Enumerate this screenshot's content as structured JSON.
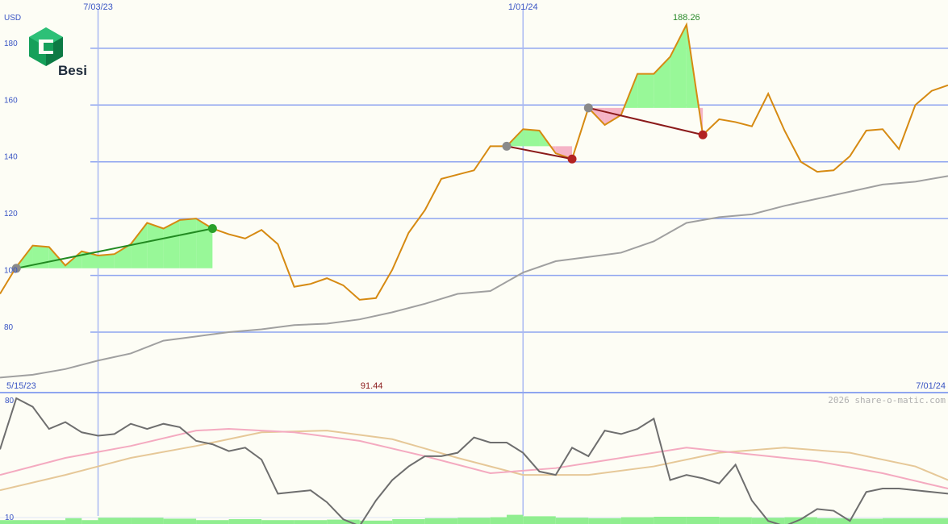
{
  "brand": {
    "name": "Besi"
  },
  "currency_label": "USD",
  "copyright": "2026 share-o-matic.com",
  "colors": {
    "background": "#fdfdf5",
    "grid": "#8fa5f0",
    "vline": "#a9b8f2",
    "axis_text": "#3a55c4",
    "price": "#d68a12",
    "moving_average": "#a0a0a0",
    "gain_fill": "#98f898",
    "loss_fill": "#f5b4c6",
    "up_trend": "#228b22",
    "down_trend": "#8b1a1a",
    "max_label": "#2a8a2a",
    "min_label": "#8b1a1a",
    "osc_main": "#6e6e6e",
    "osc_pink": "#f4aac0",
    "osc_tan": "#e6c898",
    "volume": "#90ee90",
    "logo_green": "#16a05a"
  },
  "chart_data": [
    {
      "type": "line",
      "title": "",
      "ylabel": "USD",
      "x_labels": [
        {
          "label": "7/03/23",
          "x": 6
        },
        {
          "label": "1/01/24",
          "x": 32
        }
      ],
      "range_labels": {
        "start": "5/15/23",
        "end": "7/01/24"
      },
      "ylim": [
        59,
        197
      ],
      "y_ticks": [
        80,
        100,
        120,
        140,
        160,
        180
      ],
      "max_label": {
        "label": "188.26",
        "x": 42,
        "y": 188.26
      },
      "min_label": {
        "label": "91.44",
        "x": 22,
        "y": 91.44
      },
      "series": [
        {
          "role": "price",
          "x": [
            0,
            1,
            2,
            3,
            4,
            5,
            6,
            7,
            8,
            9,
            10,
            11,
            12,
            13,
            14,
            15,
            16,
            17,
            18,
            19,
            20,
            21,
            22,
            23,
            24,
            25,
            26,
            27,
            28,
            29,
            30,
            31,
            32,
            33,
            34,
            35,
            36,
            37,
            38,
            39,
            40,
            41,
            42,
            43,
            44,
            45,
            46,
            47,
            48,
            49,
            50,
            51,
            52,
            53,
            54,
            55,
            56,
            57,
            58
          ],
          "values": [
            93.5,
            103,
            110.5,
            110,
            103.5,
            108.5,
            107,
            107.5,
            111,
            118.5,
            116.5,
            119.5,
            120,
            116.5,
            114.5,
            113,
            116,
            111,
            96,
            97,
            99,
            96.5,
            91.4,
            92,
            102,
            115,
            123,
            134,
            135.5,
            137,
            145.5,
            145.5,
            151.5,
            151,
            143,
            141,
            159,
            153,
            156.5,
            171,
            171,
            177,
            188.3,
            149.5,
            155,
            154,
            152.5,
            164,
            151,
            140,
            136.5,
            137,
            142,
            151,
            151.5,
            144.5,
            160,
            165,
            167
          ]
        },
        {
          "role": "moving_average",
          "x": [
            0,
            2,
            4,
            6,
            8,
            10,
            12,
            14,
            16,
            18,
            20,
            22,
            24,
            26,
            28,
            30,
            32,
            34,
            36,
            38,
            40,
            42,
            44,
            46,
            48,
            50,
            52,
            54,
            56,
            58
          ],
          "values": [
            64,
            65,
            67,
            70,
            72.5,
            77,
            78.5,
            80,
            81,
            82.5,
            83,
            84.5,
            87,
            90,
            93.5,
            94.5,
            101,
            105,
            106.5,
            108,
            112,
            118.5,
            120.5,
            121.5,
            124.5,
            127,
            129.5,
            132,
            133,
            135
          ]
        }
      ],
      "trend_markers": [
        {
          "x1": 1,
          "y1": 102.5,
          "x2": 13,
          "y2": 116.5,
          "direction": "up"
        },
        {
          "x1": 31,
          "y1": 145.5,
          "x2": 35,
          "y2": 141,
          "direction": "down"
        },
        {
          "x1": 36,
          "y1": 159,
          "x2": 43,
          "y2": 149.5,
          "direction": "down"
        }
      ]
    },
    {
      "type": "line",
      "title": "",
      "ylim": [
        10,
        80
      ],
      "y_ticks": [
        10,
        80
      ],
      "series": [
        {
          "role": "oscillator",
          "x": [
            0,
            1,
            2,
            3,
            4,
            5,
            6,
            7,
            8,
            9,
            10,
            11,
            12,
            13,
            14,
            15,
            16,
            17,
            18,
            19,
            20,
            21,
            22,
            23,
            24,
            25,
            26,
            27,
            28,
            29,
            30,
            31,
            32,
            33,
            34,
            35,
            36,
            37,
            38,
            39,
            40,
            41,
            42,
            43,
            44,
            45,
            46,
            47,
            48,
            49,
            50,
            51,
            52,
            53,
            54,
            55,
            56,
            57,
            58
          ],
          "values": [
            50,
            80,
            75,
            62,
            66,
            60,
            58,
            59,
            65,
            62,
            65,
            63,
            55,
            53,
            49,
            51,
            44,
            24,
            25,
            26,
            19,
            9,
            5,
            20,
            32,
            40,
            46,
            46,
            48,
            57,
            54,
            54,
            48,
            37,
            35,
            51,
            46,
            61,
            59,
            62,
            68,
            32,
            35,
            33,
            30,
            41,
            20,
            8,
            5,
            9,
            15,
            14,
            8,
            25,
            27,
            27,
            26,
            25,
            24
          ],
          "_note": "x 0-58 matches price index"
        },
        {
          "role": "signal_pink",
          "x": [
            0,
            4,
            8,
            12,
            14,
            18,
            22,
            26,
            30,
            34,
            38,
            42,
            46,
            50,
            54,
            58
          ],
          "values": [
            35,
            45,
            52,
            61,
            62,
            60,
            55,
            46,
            36,
            39,
            45,
            51,
            47,
            43,
            36,
            27
          ]
        },
        {
          "role": "signal_tan",
          "x": [
            0,
            4,
            8,
            12,
            16,
            20,
            24,
            28,
            32,
            36,
            40,
            44,
            48,
            52,
            56,
            58
          ],
          "values": [
            26,
            35,
            45,
            52,
            60,
            61,
            56,
            45,
            35,
            35,
            40,
            48,
            51,
            48,
            40,
            32
          ]
        }
      ],
      "volume": {
        "x": [
          0,
          2,
          4,
          5,
          6,
          8,
          10,
          12,
          14,
          16,
          18,
          20,
          22,
          24,
          26,
          28,
          30,
          31,
          32,
          34,
          36,
          38,
          40,
          42,
          44,
          46,
          48,
          50,
          52,
          54,
          56,
          58
        ],
        "values": [
          1.6,
          1.6,
          2.4,
          1.6,
          2.6,
          2.6,
          2.2,
          1.6,
          2.0,
          1.6,
          1.6,
          1.8,
          1.4,
          2.0,
          2.4,
          2.6,
          2.8,
          3.8,
          3.2,
          2.6,
          2.4,
          2.8,
          3.0,
          3.0,
          2.8,
          2.6,
          2.8,
          2.4,
          2.2,
          2.4,
          2.4,
          2.6
        ]
      }
    }
  ]
}
